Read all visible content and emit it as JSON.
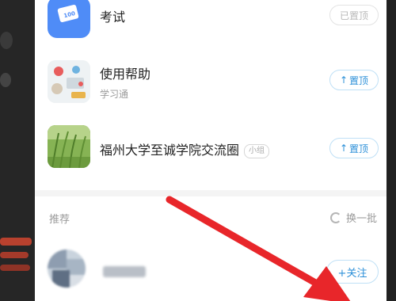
{
  "list": {
    "items": [
      {
        "title": "考试",
        "subtitle": "",
        "tag": "",
        "button": "已置顶",
        "pinned": true,
        "thumb_icon": "exam-app-icon"
      },
      {
        "title": "使用帮助",
        "subtitle": "学习通",
        "tag": "",
        "button": "置顶",
        "pinned": false,
        "thumb_icon": "help-thumbnail"
      },
      {
        "title": "福州大学至诚学院交流圈",
        "subtitle": "",
        "tag": "小组",
        "button": "置顶",
        "pinned": false,
        "thumb_icon": "plant-thumbnail"
      }
    ]
  },
  "recommend": {
    "label": "推荐",
    "refresh_label": "换一批",
    "user": {
      "name_hidden": true,
      "follow_label": "+关注"
    }
  },
  "colors": {
    "accent": "#2b8fd8",
    "exam_icon": "#4f8cf7",
    "annotation_arrow": "#e8262a"
  },
  "icons": {
    "pin": "arrow-up-icon",
    "refresh": "refresh-icon"
  }
}
